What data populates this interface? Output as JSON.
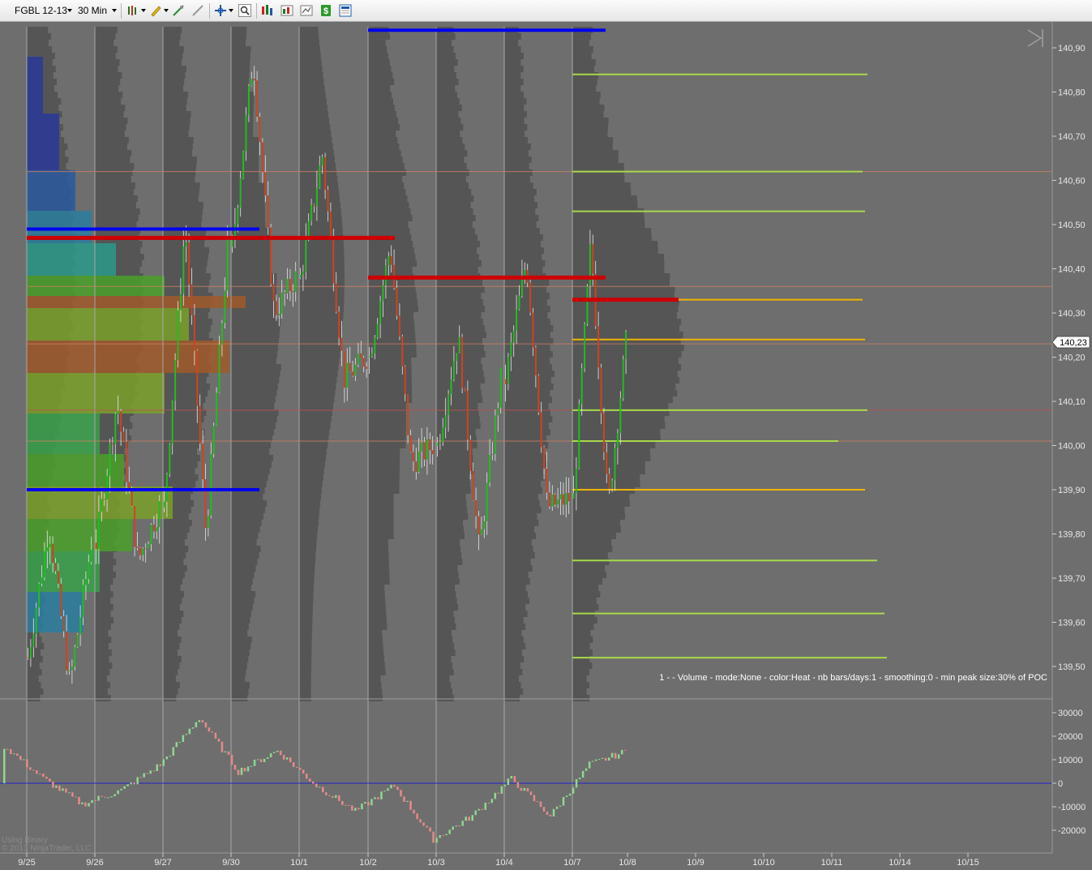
{
  "toolbar": {
    "instrument": "FGBL 12-13",
    "timeframe": "30 Min",
    "icons": [
      "bar-type-icon",
      "draw-tool-icon",
      "data-box-icon",
      "crosshair-icon",
      "zoom-icon",
      "indicators-icon",
      "strategies-icon",
      "chart-properties-icon",
      "order-icon",
      "template-icon"
    ]
  },
  "price_axis": {
    "labels": [
      "140,90",
      "140,80",
      "140,70",
      "140,60",
      "140,50",
      "140,40",
      "140,30",
      "140,20",
      "140,10",
      "140,00",
      "139,90",
      "139,80",
      "139,70",
      "139,60",
      "139,50"
    ],
    "current_price": "140,23",
    "current_color": "#ffffff"
  },
  "indicator_axis": {
    "labels": [
      "30000",
      "20000",
      "10000",
      "0",
      "-10000",
      "-20000"
    ]
  },
  "date_axis": {
    "labels": [
      "9/25",
      "9/26",
      "9/27",
      "9/30",
      "10/1",
      "10/2",
      "10/3",
      "10/4",
      "10/7",
      "10/8",
      "10/9",
      "10/10",
      "10/11",
      "10/14",
      "10/15"
    ]
  },
  "profile_info": "1 -   - Volume - mode:None  - color:Heat - nb bars/days:1 - smoothing:0 - min peak size:30% of POC",
  "watermark": {
    "line1": "Using Binary",
    "line2": "© 2013 NinjaTrader, LLC"
  },
  "colors": {
    "background": "#6e6e6e",
    "profile": "#555555",
    "poc": "#cc0000",
    "value_area": "#0000ee",
    "level_green": "#a8d94a",
    "level_orange": "#f0b400",
    "up_candle": "#22bb22",
    "down_candle": "#cc4422",
    "histo_up": "#8fd88f",
    "histo_down": "#e88a8a"
  },
  "chart_data": {
    "type": "candlestick",
    "instrument": "FGBL 12-13",
    "timeframe": "30 Min",
    "y_range": [
      139.45,
      140.96
    ],
    "sessions": [
      {
        "date": "9/25",
        "open": 139.52,
        "high": 139.82,
        "low": 139.46,
        "close": 139.78
      },
      {
        "date": "9/26",
        "open": 139.78,
        "high": 140.1,
        "low": 139.74,
        "close": 139.86
      },
      {
        "date": "9/27",
        "open": 139.86,
        "high": 140.5,
        "low": 139.8,
        "close": 140.45
      },
      {
        "date": "9/30",
        "open": 140.45,
        "high": 140.88,
        "low": 140.3,
        "close": 140.38
      },
      {
        "date": "10/1",
        "open": 140.38,
        "high": 140.66,
        "low": 140.15,
        "close": 140.2
      },
      {
        "date": "10/2",
        "open": 140.2,
        "high": 140.45,
        "low": 139.96,
        "close": 140.0
      },
      {
        "date": "10/3",
        "open": 140.0,
        "high": 140.25,
        "low": 139.76,
        "close": 140.15
      },
      {
        "date": "10/4",
        "open": 140.15,
        "high": 140.42,
        "low": 139.86,
        "close": 139.88
      },
      {
        "date": "10/7",
        "open": 139.88,
        "high": 140.46,
        "low": 139.86,
        "close": 140.23
      }
    ],
    "poc_levels": [
      {
        "from": "9/25",
        "to": "10/2",
        "price": 140.47
      },
      {
        "from": "10/2",
        "to": "10/7",
        "price": 140.38
      },
      {
        "from": "10/7",
        "to": "10/8",
        "price": 140.33
      }
    ],
    "value_area_levels": [
      {
        "from": "9/25",
        "to": "9/30",
        "price": 140.49
      },
      {
        "from": "9/25",
        "to": "9/30",
        "price": 139.9
      },
      {
        "from": "10/2",
        "to": "10/7",
        "price": 140.94
      }
    ],
    "projected_levels": [
      {
        "price": 140.84,
        "color": "green"
      },
      {
        "price": 140.62,
        "color": "green"
      },
      {
        "price": 140.53,
        "color": "green"
      },
      {
        "price": 140.33,
        "color": "orange"
      },
      {
        "price": 140.24,
        "color": "orange"
      },
      {
        "price": 140.08,
        "color": "green"
      },
      {
        "price": 140.01,
        "color": "green"
      },
      {
        "price": 139.9,
        "color": "orange"
      },
      {
        "price": 139.74,
        "color": "green"
      },
      {
        "price": 139.62,
        "color": "green"
      },
      {
        "price": 139.52,
        "color": "green"
      }
    ],
    "indicator": {
      "type": "histogram",
      "y_range": [
        -25000,
        30000
      ],
      "values": [
        16000,
        2000,
        -9000,
        -3000,
        8000,
        28000,
        5000,
        14000,
        -1000,
        -12000,
        -1000,
        -24000,
        -14000,
        2000,
        -14000,
        8000,
        14000
      ]
    }
  }
}
